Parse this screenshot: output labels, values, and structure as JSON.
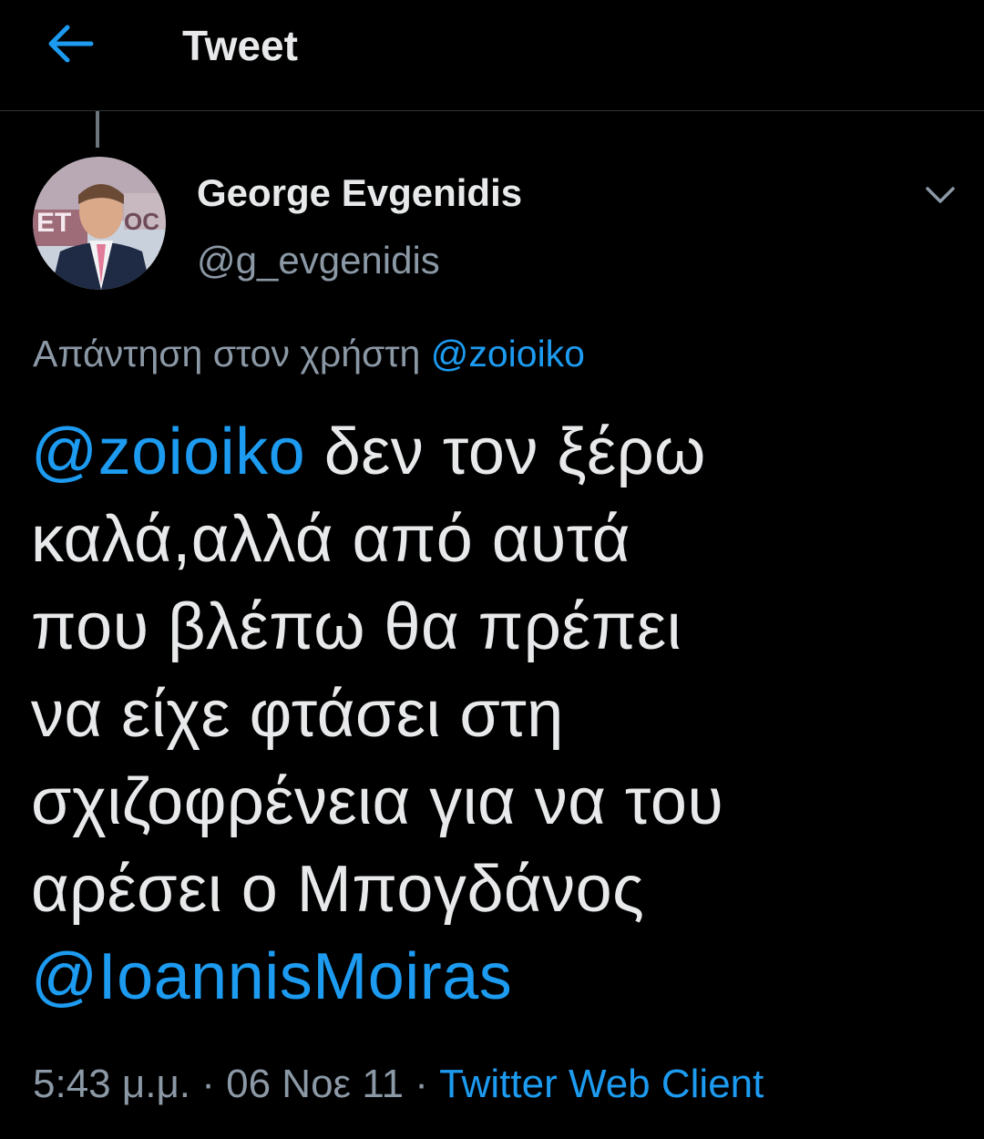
{
  "colors": {
    "background": "#000000",
    "primary_text": "#e7e9ea",
    "secondary_text": "#8b98a5",
    "accent": "#1d9bf0",
    "divider": "#2f3336"
  },
  "header": {
    "back_icon": "arrow-left-icon",
    "title": "Tweet"
  },
  "author": {
    "name": "George Evgenidis",
    "handle": "@g_evgenidis",
    "avatar_icon": "profile-photo-avatar",
    "more_icon": "chevron-down-icon"
  },
  "reply_context": {
    "prefix": "Απάντηση στον χρήστη",
    "mention": "@zoioiko"
  },
  "tweet": {
    "mention_start": "@zoioiko",
    "line1_rest": " δεν τον ξέρω",
    "line2": "καλά,αλλά από αυτά",
    "line3": "που βλέπω θα πρέπει",
    "line4": "να είχε φτάσει στη",
    "line5": "σχιζοφρένεια για να του",
    "line6": "αρέσει ο Μπογδάνος",
    "mention_end": "@IoannisMoiras"
  },
  "meta": {
    "time": "5:43 μ.μ.",
    "separator": " · ",
    "date": "06 Νοε 11",
    "source": "Twitter Web Client"
  }
}
